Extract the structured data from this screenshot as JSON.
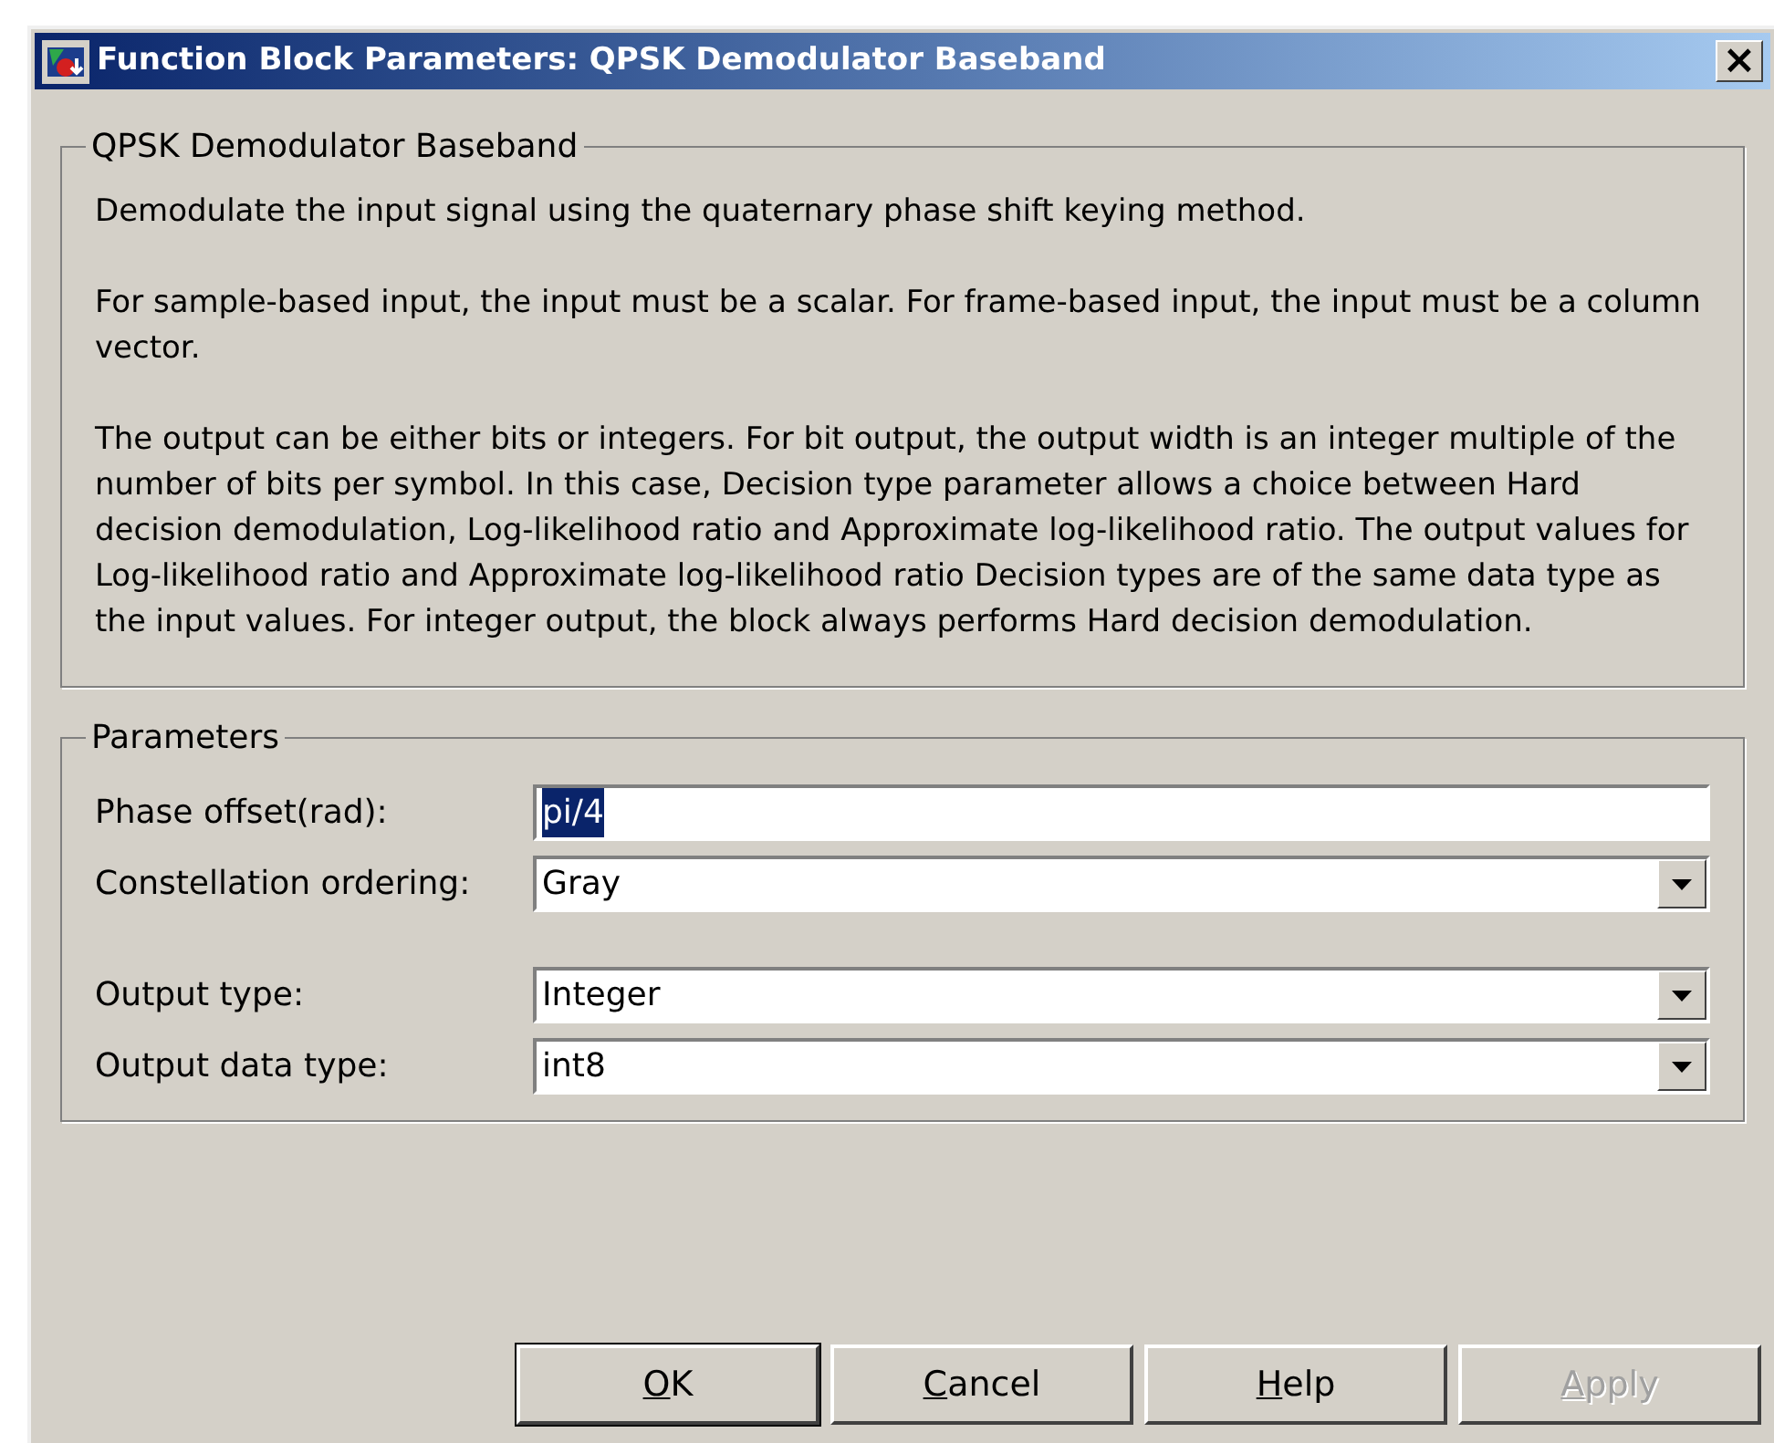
{
  "window": {
    "title": "Function Block Parameters: QPSK Demodulator Baseband",
    "close": "×"
  },
  "description_group": {
    "title": "QPSK Demodulator Baseband",
    "paragraphs": [
      "Demodulate the input signal using the quaternary phase shift keying method.",
      "For sample-based input, the input must be a scalar. For frame-based input, the input must be a column vector.",
      "The output can be either bits or integers. For bit output, the output width is an integer multiple of the number of bits per symbol. In this case, Decision type parameter allows a choice between Hard decision demodulation, Log-likelihood ratio and Approximate log-likelihood ratio.  The output values for Log-likelihood ratio and Approximate log-likelihood ratio Decision types are of the same data type as the input values. For integer output, the block always performs Hard decision demodulation."
    ]
  },
  "parameters_group": {
    "title": "Parameters",
    "sections": [
      {
        "fields": [
          {
            "kind": "edit",
            "label": "Phase offset(rad):",
            "value": "pi/4",
            "text_selected": true
          },
          {
            "kind": "dropdown",
            "label": "Constellation ordering:",
            "value": "Gray"
          }
        ]
      },
      {
        "fields": [
          {
            "kind": "dropdown",
            "label": "Output type:",
            "value": "Integer"
          },
          {
            "kind": "dropdown",
            "label": "Output data type:",
            "value": "int8"
          }
        ]
      }
    ]
  },
  "buttons": [
    {
      "label": "OK",
      "disabled": false,
      "default": true
    },
    {
      "label": "Cancel",
      "disabled": false,
      "default": false
    },
    {
      "label": "Help",
      "disabled": false,
      "default": false
    },
    {
      "label": "Apply",
      "disabled": true,
      "default": false
    }
  ]
}
